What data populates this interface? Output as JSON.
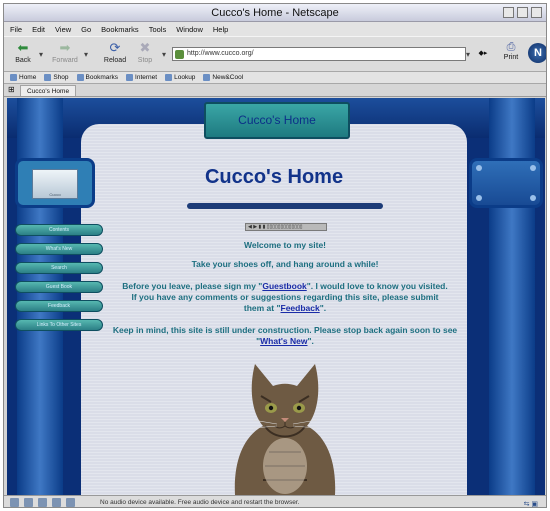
{
  "window": {
    "title": "Cucco's Home - Netscape"
  },
  "menu": [
    "File",
    "Edit",
    "View",
    "Go",
    "Bookmarks",
    "Tools",
    "Window",
    "Help"
  ],
  "nav": {
    "back": "Back",
    "forward": "Forward",
    "reload": "Reload",
    "stop": "Stop",
    "print": "Print",
    "url": "http://www.cucco.org/"
  },
  "personal_bar": [
    "Home",
    "Shop",
    "Bookmarks",
    "Internet",
    "Lookup",
    "New&Cool"
  ],
  "tab": {
    "label": "Cucco's Home"
  },
  "site": {
    "header_tab": "Cucco's Home",
    "left_box_caption": "Cucco",
    "nav_items": [
      "Contents",
      "What's New",
      "Search",
      "Guest Book",
      "Feedback",
      "Links To Other Sites"
    ],
    "title": "Cucco's Home",
    "welcome": "Welcome to my site!",
    "shoes": "Take your shoes off, and hang around a while!",
    "guest_pre": "Before you leave, please sign my \"",
    "guest_link": "Guestbook",
    "guest_mid": "\". I would love to know you visited. If you have any comments or suggestions regarding this site, please submit them at \"",
    "feedback_link": "Feedback",
    "guest_end": "\".",
    "construction": "Keep in mind, this site is still under construction. Please stop back again soon to see \"",
    "whatsnew_link": "What's New",
    "construction_end": "\"."
  },
  "status": {
    "text": "No audio device available. Free audio device and restart the browser."
  }
}
